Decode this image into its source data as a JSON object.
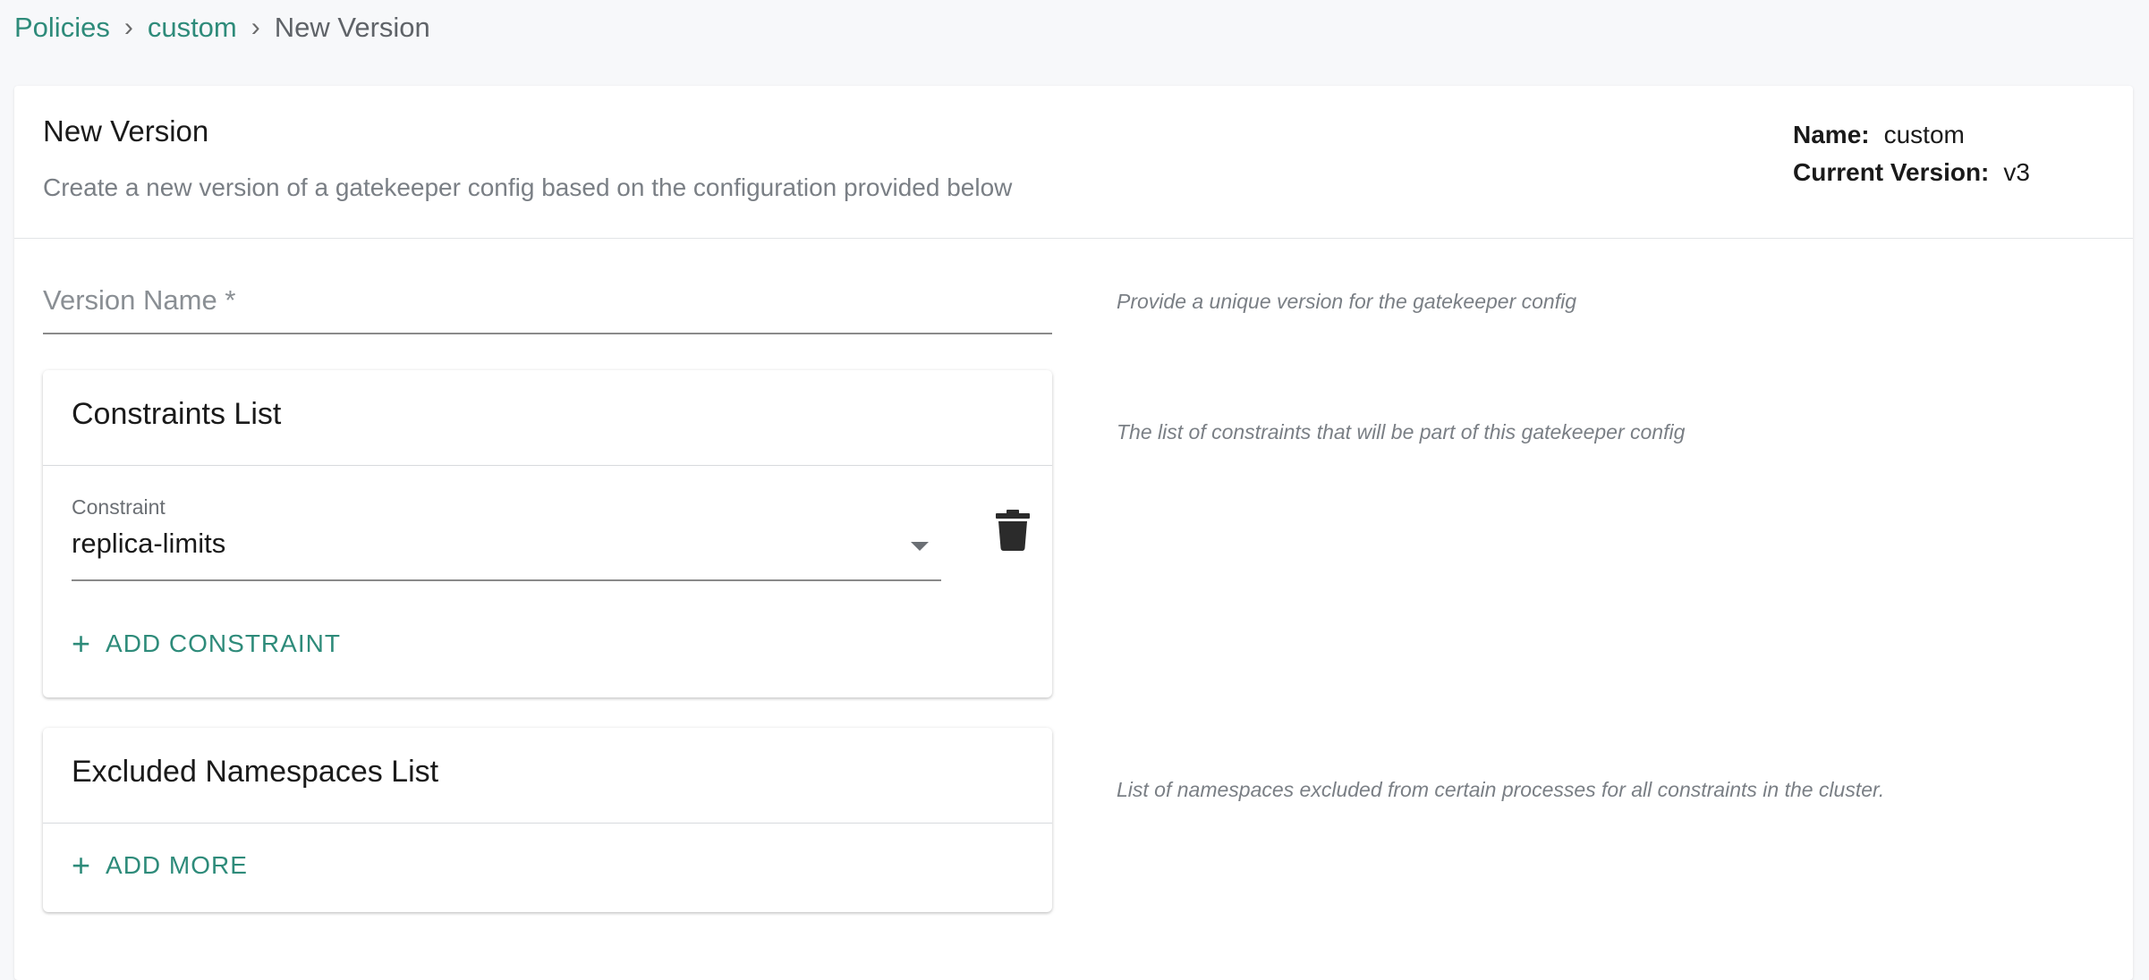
{
  "breadcrumb": {
    "items": [
      "Policies",
      "custom"
    ],
    "current": "New Version",
    "separator": "›"
  },
  "header": {
    "title": "New Version",
    "subtitle": "Create a new version of a gatekeeper config based on the configuration provided below",
    "meta": {
      "name_label": "Name:",
      "name_value": "custom",
      "version_label": "Current Version:",
      "version_value": "v3"
    }
  },
  "form": {
    "version_name": {
      "placeholder": "Version Name *",
      "value": "",
      "hint": "Provide a unique version for the gatekeeper config"
    },
    "constraints": {
      "title": "Constraints List",
      "hint": "The list of constraints that will be part of this gatekeeper config",
      "items": [
        {
          "label": "Constraint",
          "value": "replica-limits"
        }
      ],
      "add_label": "ADD CONSTRAINT",
      "add_icon": "plus-icon",
      "delete_icon": "trash-icon"
    },
    "excluded_namespaces": {
      "title": "Excluded Namespaces List",
      "hint": "List of namespaces excluded from certain processes for all constraints in the cluster.",
      "add_label": "ADD MORE",
      "add_icon": "plus-icon"
    }
  },
  "colors": {
    "accent": "#2e8b7a",
    "muted": "#7a7f85",
    "background": "#f7f8fa"
  }
}
